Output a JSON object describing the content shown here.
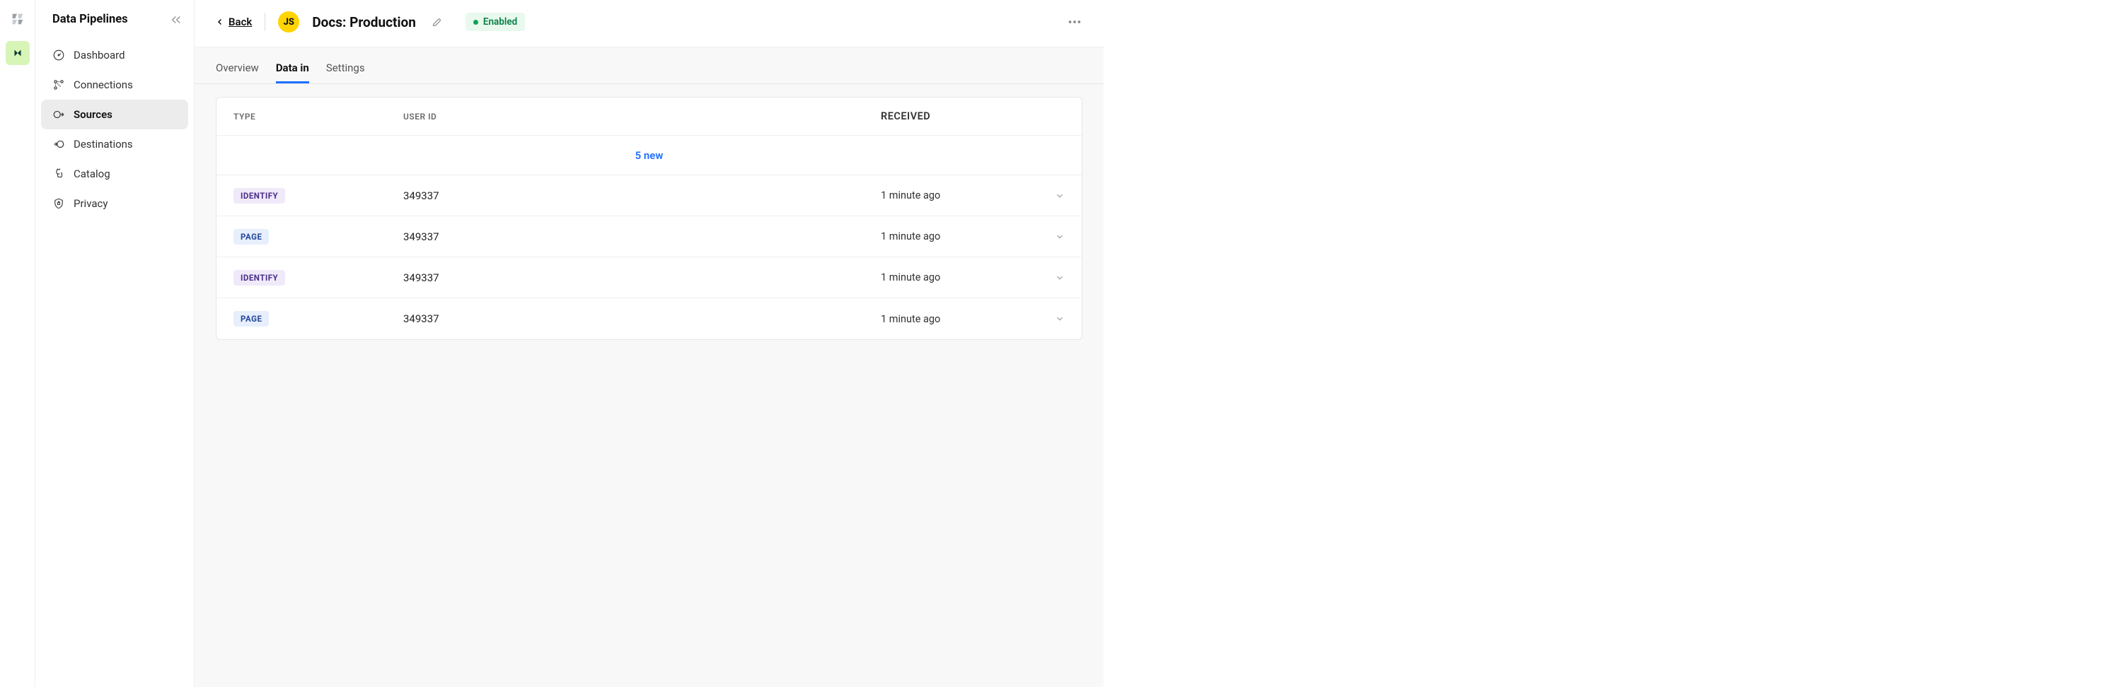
{
  "sidebar": {
    "title": "Data Pipelines",
    "items": [
      {
        "label": "Dashboard"
      },
      {
        "label": "Connections"
      },
      {
        "label": "Sources"
      },
      {
        "label": "Destinations"
      },
      {
        "label": "Catalog"
      },
      {
        "label": "Privacy"
      }
    ],
    "active_index": 2
  },
  "header": {
    "back_label": "Back",
    "source_badge": "JS",
    "source_title": "Docs: Production",
    "status_label": "Enabled"
  },
  "tabs": {
    "items": [
      {
        "label": "Overview"
      },
      {
        "label": "Data in"
      },
      {
        "label": "Settings"
      }
    ],
    "active_index": 1
  },
  "table": {
    "columns": {
      "type": "TYPE",
      "user_id": "USER ID",
      "received": "RECEIVED"
    },
    "new_banner": "5 new",
    "rows": [
      {
        "type": "IDENTIFY",
        "type_class": "identify",
        "user_id": "349337",
        "received": "1 minute ago"
      },
      {
        "type": "PAGE",
        "type_class": "page",
        "user_id": "349337",
        "received": "1 minute ago"
      },
      {
        "type": "IDENTIFY",
        "type_class": "identify",
        "user_id": "349337",
        "received": "1 minute ago"
      },
      {
        "type": "PAGE",
        "type_class": "page",
        "user_id": "349337",
        "received": "1 minute ago"
      }
    ]
  }
}
